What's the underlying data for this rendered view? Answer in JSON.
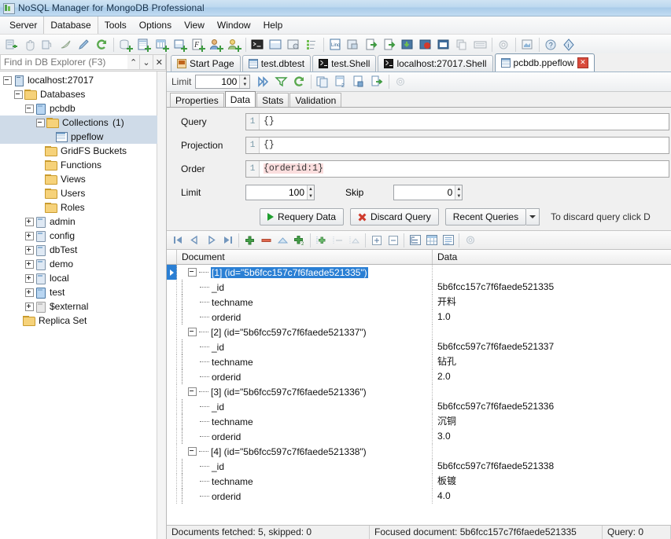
{
  "window": {
    "title": "NoSQL Manager for MongoDB Professional",
    "icon": "app-icon"
  },
  "menubar": {
    "items": [
      "Server",
      "Database",
      "Tools",
      "Options",
      "View",
      "Window",
      "Help"
    ],
    "selected": "Database"
  },
  "toolbar": {
    "groups": [
      [
        "connect-server-icon",
        "disconnect-server-icon",
        "server-status-icon",
        "edit-connection-icon",
        "new-connection-icon",
        "refresh-icon"
      ],
      [
        "new-database-icon",
        "new-collection-icon",
        "new-view-icon",
        "new-gridfs-icon",
        "new-function-icon",
        "new-user-icon",
        "new-role-icon"
      ],
      [
        "shell-icon",
        "query-window-icon",
        "aggregation-icon",
        "index-manager-icon"
      ],
      [
        "linq-query-icon",
        "sql-query-icon",
        "import-icon",
        "export-icon",
        "backup-icon",
        "restore-icon",
        "report-icon",
        "clone-icon",
        "keyboard-icon"
      ],
      [
        "options-icon"
      ],
      [
        "start-page-icon"
      ],
      [
        "help-icon",
        "about-icon"
      ]
    ]
  },
  "explorer": {
    "find": {
      "placeholder": "Find in DB Explorer (F3)",
      "value": "",
      "prev_label": "⌃",
      "next_label": "⌄",
      "close_label": "✕"
    },
    "tree": [
      {
        "label": "localhost:27017",
        "depth": 0,
        "icon": "server-icon",
        "expander": "minus",
        "selected": false
      },
      {
        "label": "Databases",
        "depth": 1,
        "icon": "folder-icon",
        "expander": "minus",
        "selected": false
      },
      {
        "label": "pcbdb",
        "depth": 2,
        "icon": "database-icon-blue",
        "expander": "minus",
        "selected": false
      },
      {
        "label": "Collections",
        "depth": 3,
        "icon": "folder-icon",
        "expander": "minus",
        "selected": true,
        "suffix": "(1)"
      },
      {
        "label": "ppeflow",
        "depth": 4,
        "icon": "collection-icon",
        "expander": "leaf",
        "selected": true
      },
      {
        "label": "GridFS Buckets",
        "depth": 3,
        "icon": "folder-icon",
        "expander": "leaf",
        "selected": false
      },
      {
        "label": "Functions",
        "depth": 3,
        "icon": "folder-icon",
        "expander": "leaf",
        "selected": false
      },
      {
        "label": "Views",
        "depth": 3,
        "icon": "folder-icon",
        "expander": "leaf",
        "selected": false
      },
      {
        "label": "Users",
        "depth": 3,
        "icon": "folder-icon",
        "expander": "leaf",
        "selected": false
      },
      {
        "label": "Roles",
        "depth": 3,
        "icon": "folder-icon",
        "expander": "leaf",
        "selected": false
      },
      {
        "label": "admin",
        "depth": 2,
        "icon": "database-icon",
        "expander": "plus",
        "selected": false
      },
      {
        "label": "config",
        "depth": 2,
        "icon": "database-icon",
        "expander": "plus",
        "selected": false
      },
      {
        "label": "dbTest",
        "depth": 2,
        "icon": "database-icon",
        "expander": "plus",
        "selected": false
      },
      {
        "label": "demo",
        "depth": 2,
        "icon": "database-icon",
        "expander": "plus",
        "selected": false
      },
      {
        "label": "local",
        "depth": 2,
        "icon": "database-icon",
        "expander": "plus",
        "selected": false
      },
      {
        "label": "test",
        "depth": 2,
        "icon": "database-icon-blue",
        "expander": "plus",
        "selected": false
      },
      {
        "label": "$external",
        "depth": 2,
        "icon": "database-icon-gray",
        "expander": "plus",
        "selected": false,
        "disabled": true
      },
      {
        "label": "Replica Set",
        "depth": 1,
        "icon": "folder-icon",
        "expander": "leaf",
        "selected": false
      }
    ]
  },
  "tabs": [
    {
      "label": "Start Page",
      "icon": "start-page-icon",
      "active": false,
      "closable": false
    },
    {
      "label": "test.dbtest",
      "icon": "collection-icon",
      "active": false,
      "closable": false
    },
    {
      "label": "test.Shell",
      "icon": "shell-icon",
      "active": false,
      "closable": false
    },
    {
      "label": "localhost:27017.Shell",
      "icon": "shell-icon",
      "active": false,
      "closable": false
    },
    {
      "label": "pcbdb.ppeflow",
      "icon": "collection-icon",
      "active": true,
      "closable": true,
      "close_label": "✕"
    }
  ],
  "query_toolbar": {
    "limit_label": "Limit",
    "limit_value": "100",
    "icons": [
      "run-all-icon",
      "filter-icon",
      "refresh-icon",
      "copy-document-icon",
      "copy-document-2-icon",
      "paste-document-icon",
      "export-document-icon",
      "settings-icon"
    ]
  },
  "subtabs": {
    "items": [
      "Properties",
      "Data",
      "Stats",
      "Validation"
    ],
    "active": "Data"
  },
  "query_form": {
    "query": {
      "label": "Query",
      "line": "1",
      "value": "{}"
    },
    "projection": {
      "label": "Projection",
      "line": "1",
      "value": "{}"
    },
    "order": {
      "label": "Order",
      "line": "1",
      "value": "{orderid:1}",
      "highlighted": true
    },
    "limit": {
      "label": "Limit",
      "value": "100"
    },
    "skip": {
      "label": "Skip",
      "value": "0"
    },
    "requery_label": "Requery Data",
    "discard_label": "Discard Query",
    "recent_label": "Recent Queries",
    "hint": "To discard query click D"
  },
  "grid_toolbar": {
    "icons": [
      "first-record-icon",
      "prev-record-icon",
      "next-record-icon",
      "last-record-icon",
      "add-record-icon",
      "delete-record-icon",
      "edit-record-icon",
      "duplicate-record-icon",
      "add-field-icon",
      "remove-field-icon",
      "edit-field-icon",
      "expand-all-icon",
      "collapse-all-icon",
      "tree-view-icon",
      "table-view-icon",
      "text-view-icon",
      "grid-settings-icon"
    ]
  },
  "grid": {
    "columns": [
      "Document",
      "Data"
    ],
    "rows": [
      {
        "type": "doc",
        "document": "[1] (id=\"5b6fcc157c7f6faede521335\")",
        "data": "",
        "selected": true
      },
      {
        "type": "leaf",
        "document": "_id",
        "data": "5b6fcc157c7f6faede521335"
      },
      {
        "type": "leaf",
        "document": "techname",
        "data": "开料",
        "cjk": true
      },
      {
        "type": "leaf",
        "document": "orderid",
        "data": "1.0",
        "last": true
      },
      {
        "type": "doc",
        "document": "[2] (id=\"5b6fcc597c7f6faede521337\")",
        "data": ""
      },
      {
        "type": "leaf",
        "document": "_id",
        "data": "5b6fcc597c7f6faede521337"
      },
      {
        "type": "leaf",
        "document": "techname",
        "data": "钻孔",
        "cjk": true
      },
      {
        "type": "leaf",
        "document": "orderid",
        "data": "2.0",
        "last": true
      },
      {
        "type": "doc",
        "document": "[3] (id=\"5b6fcc597c7f6faede521336\")",
        "data": ""
      },
      {
        "type": "leaf",
        "document": "_id",
        "data": "5b6fcc597c7f6faede521336"
      },
      {
        "type": "leaf",
        "document": "techname",
        "data": "沉铜",
        "cjk": true
      },
      {
        "type": "leaf",
        "document": "orderid",
        "data": "3.0",
        "last": true
      },
      {
        "type": "doc",
        "document": "[4] (id=\"5b6fcc597c7f6faede521338\")",
        "data": ""
      },
      {
        "type": "leaf",
        "document": "_id",
        "data": "5b6fcc597c7f6faede521338"
      },
      {
        "type": "leaf",
        "document": "techname",
        "data": "板镀",
        "cjk": true
      },
      {
        "type": "leaf",
        "document": "orderid",
        "data": "4.0",
        "last": true
      }
    ]
  },
  "statusbar": {
    "fetched": "Documents fetched: 5, skipped: 0",
    "focused": "Focused document: 5b6fcc157c7f6faede521335",
    "query": "Query: 0"
  },
  "colors": {
    "accent_selection": "#2a7fd4",
    "tree_selection": "#cfdbe8",
    "highlight_bg": "#fbdede",
    "title_gradient_top": "#cfe3f3",
    "green": "#1f9e2e",
    "red": "#cf3a2c"
  }
}
